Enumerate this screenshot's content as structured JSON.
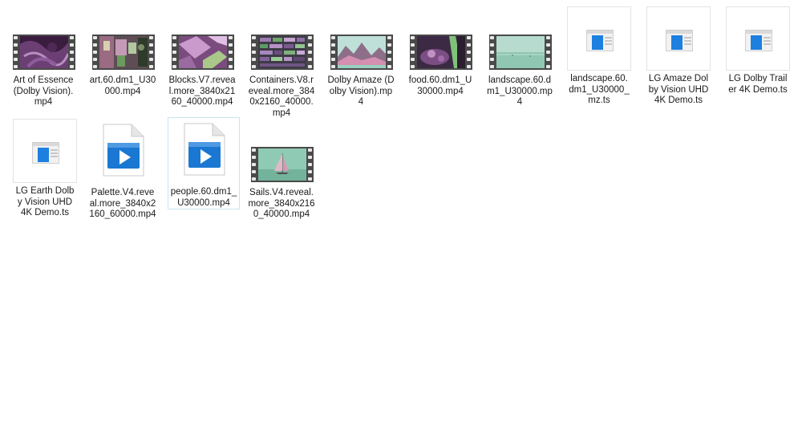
{
  "items": [
    {
      "name": "Art of Essence (Dolby Vision).mp4",
      "kind": "video",
      "thumb": "art-of-essence"
    },
    {
      "name": "art.60.dm1_U30000.mp4",
      "kind": "video",
      "thumb": "art"
    },
    {
      "name": "Blocks.V7.reveal.more_3840x2160_40000.mp4",
      "kind": "video",
      "thumb": "blocks"
    },
    {
      "name": "Containers.V8.reveal.more_3840x2160_40000.mp4",
      "kind": "video",
      "thumb": "containers"
    },
    {
      "name": "Dolby Amaze (Dolby Vision).mp4",
      "kind": "video",
      "thumb": "dolby-amaze"
    },
    {
      "name": "food.60.dm1_U30000.mp4",
      "kind": "video",
      "thumb": "food"
    },
    {
      "name": "landscape.60.dm1_U30000.mp4",
      "kind": "video",
      "thumb": "landscape"
    },
    {
      "name": "landscape.60.dm1_U30000_mz.ts",
      "kind": "ts"
    },
    {
      "name": "LG Amaze Dolby Vision UHD 4K Demo.ts",
      "kind": "ts"
    },
    {
      "name": "LG Dolby Trailer 4K Demo.ts",
      "kind": "ts"
    },
    {
      "name": "LG Earth Dolby Vision UHD 4K Demo.ts",
      "kind": "ts"
    },
    {
      "name": "Palette.V4.reveal.more_3840x2160_60000.mp4",
      "kind": "doc-video"
    },
    {
      "name": "people.60.dm1_U30000.mp4",
      "kind": "doc-video",
      "focused": true
    },
    {
      "name": "Sails.V4.reveal.more_3840x2160_40000.mp4",
      "kind": "video",
      "thumb": "sails"
    }
  ],
  "colors": {
    "film": "#4a4a4a",
    "focus_border": "#c6e6ee",
    "doc_play_blue": "#1a78d2",
    "ts_blue": "#1d7fe0"
  },
  "icons": {
    "video": "film-strip-thumbnail-icon",
    "ts": "generic-window-file-icon",
    "doc-video": "video-document-play-icon"
  }
}
